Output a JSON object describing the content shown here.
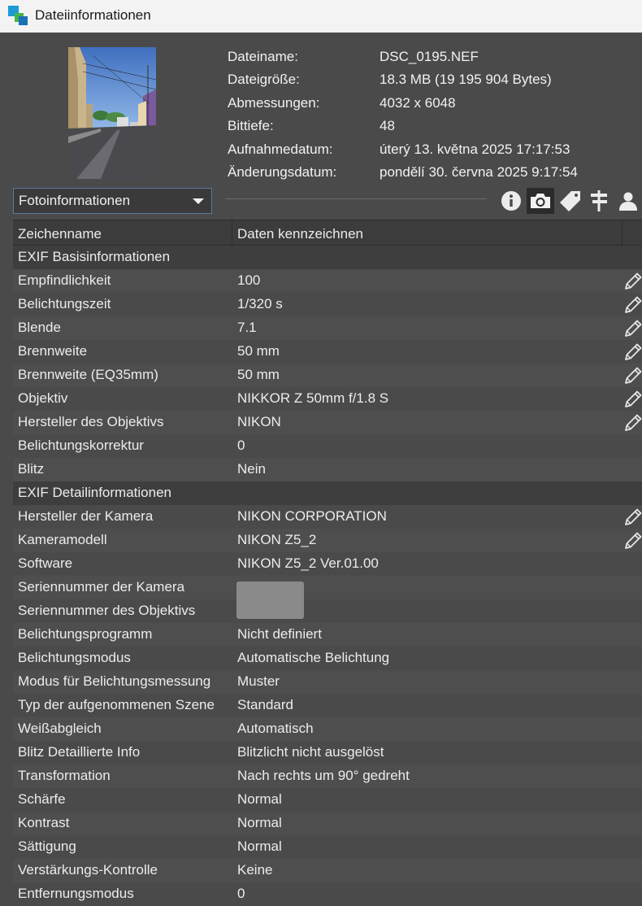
{
  "window": {
    "title": "Dateiinformationen"
  },
  "file_info": [
    {
      "label": "Dateiname:",
      "value": "DSC_0195.NEF"
    },
    {
      "label": "Dateigröße:",
      "value": "18.3 MB (19 195 904 Bytes)"
    },
    {
      "label": "Abmessungen:",
      "value": "4032 x 6048"
    },
    {
      "label": "Bittiefe:",
      "value": "48"
    },
    {
      "label": "Aufnahmedatum:",
      "value": "úterý 13. května 2025 17:17:53"
    },
    {
      "label": "Änderungsdatum:",
      "value": "pondělí 30. června 2025 9:17:54"
    }
  ],
  "dropdown": {
    "selected": "Fotoinformationen"
  },
  "toolbar": [
    "info-icon",
    "camera-icon",
    "tag-icon",
    "signpost-icon",
    "person-icon"
  ],
  "table": {
    "headers": [
      "Zeichenname",
      "Daten kennzeichnen"
    ],
    "rows": [
      {
        "type": "section",
        "name": "EXIF Basisinformationen",
        "value": ""
      },
      {
        "name": "Empfindlichkeit",
        "value": "100",
        "editable": true
      },
      {
        "name": "Belichtungszeit",
        "value": "1/320 s",
        "editable": true
      },
      {
        "name": "Blende",
        "value": "7.1",
        "editable": true
      },
      {
        "name": "Brennweite",
        "value": "50 mm",
        "editable": true
      },
      {
        "name": "Brennweite (EQ35mm)",
        "value": "50 mm",
        "editable": true
      },
      {
        "name": "Objektiv",
        "value": "NIKKOR Z 50mm f/1.8 S",
        "editable": true
      },
      {
        "name": "Hersteller des Objektivs",
        "value": "NIKON",
        "editable": true
      },
      {
        "name": "Belichtungskorrektur",
        "value": "0",
        "editable": false
      },
      {
        "name": "Blitz",
        "value": "Nein",
        "editable": false
      },
      {
        "type": "section",
        "name": "EXIF Detailinformationen",
        "value": ""
      },
      {
        "name": "Hersteller der Kamera",
        "value": "NIKON CORPORATION",
        "editable": true
      },
      {
        "name": "Kameramodell",
        "value": "NIKON Z5_2",
        "editable": true
      },
      {
        "name": "Software",
        "value": "NIKON Z5_2 Ver.01.00",
        "editable": false
      },
      {
        "name": "Seriennummer der Kamera",
        "value": "",
        "editable": false
      },
      {
        "name": "Seriennummer des Objektivs",
        "value": "",
        "editable": false
      },
      {
        "name": "Belichtungsprogramm",
        "value": "Nicht definiert",
        "editable": false
      },
      {
        "name": "Belichtungsmodus",
        "value": "Automatische Belichtung",
        "editable": false
      },
      {
        "name": "Modus für Belichtungsmessung",
        "value": "Muster",
        "editable": false
      },
      {
        "name": "Typ der aufgenommenen Szene",
        "value": "Standard",
        "editable": false
      },
      {
        "name": "Weißabgleich",
        "value": "Automatisch",
        "editable": false
      },
      {
        "name": "Blitz Detaillierte Info",
        "value": "Blitzlicht nicht ausgelöst",
        "editable": false
      },
      {
        "name": "Transformation",
        "value": "Nach rechts um 90° gedreht",
        "editable": false
      },
      {
        "name": "Schärfe",
        "value": "Normal",
        "editable": false
      },
      {
        "name": "Kontrast",
        "value": "Normal",
        "editable": false
      },
      {
        "name": "Sättigung",
        "value": "Normal",
        "editable": false
      },
      {
        "name": "Verstärkungs-Kontrolle",
        "value": "Keine",
        "editable": false
      },
      {
        "name": "Entfernungsmodus",
        "value": "0",
        "editable": false
      }
    ]
  }
}
